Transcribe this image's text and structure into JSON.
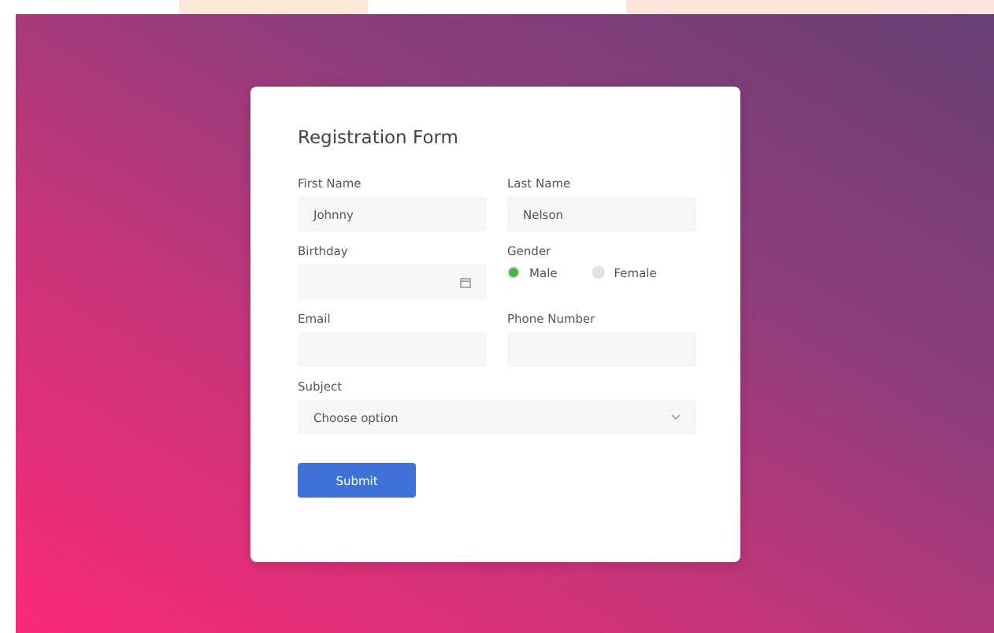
{
  "form": {
    "title": "Registration Form",
    "fields": [
      {
        "kind": "text",
        "label": "First Name",
        "value": "Johnny"
      },
      {
        "kind": "text",
        "label": "Last Name",
        "value": "Nelson"
      },
      {
        "kind": "date",
        "label": "Birthday"
      },
      {
        "kind": "radio",
        "label": "Gender",
        "options": [
          {
            "label": "Male",
            "selected": true
          },
          {
            "label": "Female",
            "selected": false
          }
        ]
      },
      {
        "kind": "text",
        "label": "Email"
      },
      {
        "kind": "text",
        "label": "Phone Number"
      },
      {
        "kind": "select",
        "label": "Subject",
        "value": "Choose option"
      }
    ],
    "submit": "Submit"
  }
}
